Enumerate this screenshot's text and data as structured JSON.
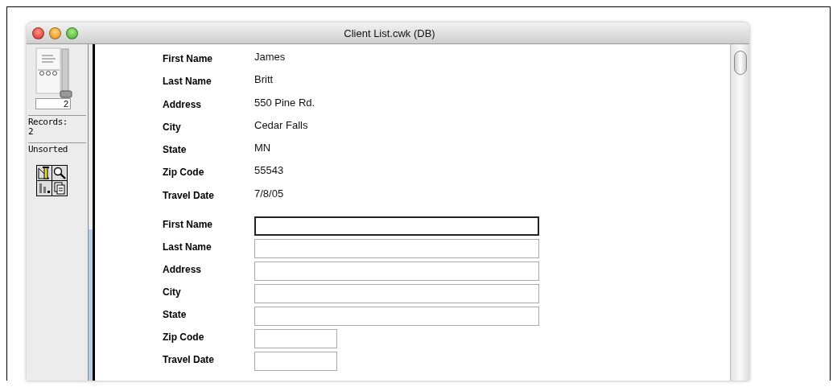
{
  "window": {
    "title": "Client List.cwk (DB)"
  },
  "sidebar": {
    "record_number": "2",
    "records_label": "Records:",
    "records_count": "2",
    "sort_status": "Unsorted"
  },
  "records": [
    {
      "kind": "display",
      "fields": [
        {
          "label": "First Name",
          "value": "James"
        },
        {
          "label": "Last Name",
          "value": "Britt"
        },
        {
          "label": "Address",
          "value": "550 Pine Rd."
        },
        {
          "label": "City",
          "value": "Cedar Falls"
        },
        {
          "label": "State",
          "value": "MN"
        },
        {
          "label": "Zip Code",
          "value": "55543"
        },
        {
          "label": "Travel Date",
          "value": "7/8/05"
        }
      ]
    },
    {
      "kind": "entry",
      "fields": [
        {
          "label": "First Name",
          "kind": "long",
          "focused": true
        },
        {
          "label": "Last Name",
          "kind": "long",
          "focused": false
        },
        {
          "label": "Address",
          "kind": "long",
          "focused": false
        },
        {
          "label": "City",
          "kind": "long",
          "focused": false
        },
        {
          "label": "State",
          "kind": "long",
          "focused": false
        },
        {
          "label": "Zip Code",
          "kind": "short",
          "focused": false
        },
        {
          "label": "Travel Date",
          "kind": "short",
          "focused": false
        }
      ]
    }
  ]
}
